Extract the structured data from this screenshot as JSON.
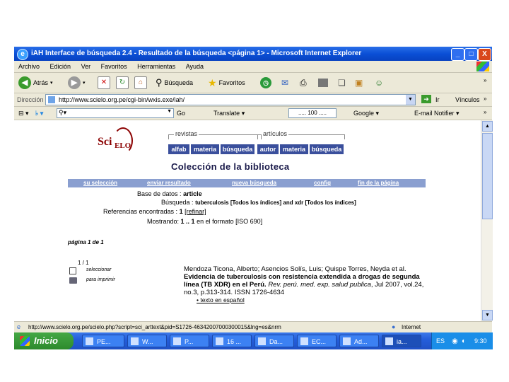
{
  "window": {
    "title": "iAH Interface de búsqueda 2.4 - Resultado de la búsqueda <página 1> - Microsoft Internet Explorer",
    "min_label": "_",
    "max_label": "□",
    "close_label": "X"
  },
  "menubar": [
    "Archivo",
    "Edición",
    "Ver",
    "Favoritos",
    "Herramientas",
    "Ayuda"
  ],
  "toolbar": {
    "back_label": "Atrás",
    "search_label": "Búsqueda",
    "favorites_label": "Favoritos"
  },
  "address": {
    "label": "Dirección",
    "url": "http://www.scielo.org.pe/cgi-bin/wxis.exe/iah/",
    "go_label": "Ir",
    "links_label": "Vínculos"
  },
  "linksbar": {
    "go_label": "Go",
    "translate_label": "Translate",
    "zoom_value": "..... 100 .....",
    "google_label": "Google",
    "email_label": "E-mail Notifier"
  },
  "page": {
    "logo_sci": "Sci",
    "logo_elo": "ELO",
    "revistas_label": "revistas",
    "articulos_label": "artículos",
    "nav": [
      "alfab",
      "materia",
      "búsqueda",
      "autor",
      "materia",
      "búsqueda"
    ],
    "heading": "Colección de la biblioteca",
    "actions": [
      "su selección",
      "enviar resultado",
      "nueva búsqueda",
      "config",
      "fin de la página"
    ],
    "db_label": "Base de datos :",
    "db_value": "article",
    "search_label": "Búsqueda :",
    "search_value": "tuberculosis [Todos los índices] and xdr [Todos los índices]",
    "refs_label": "Referencias encontradas :",
    "refs_value": "1",
    "refine_label": "[refinar]",
    "showing_label": "Mostrando:",
    "showing_value": "1 .. 1",
    "format_value": "en el formato [ISO 690]",
    "pagination": "página 1 de 1",
    "result_index": "1 / 1",
    "select_label": "seleccionar",
    "print_label": "para imprimir",
    "reference": {
      "authors": "Mendoza Ticona, Alberto; Asencios Solís, Luis; Quispe Torres, Neyda et al.",
      "title": "Evidencia de tuberculosis con resistencia extendida a drogas de segunda línea (TB XDR) en el Perú.",
      "journal": "Rev. perú. med. exp. salud publica",
      "details": ", Jul 2007, vol.24, no.3, p.313-314. ISSN 1726-4634",
      "fulltext": "• texto en español"
    }
  },
  "statusbar": {
    "url": "http://www.scielo.org.pe/scielo.php?script=sci_arttext&pid=S1726-46342007000300015&lng=es&nrm",
    "zone": "Internet"
  },
  "taskbar": {
    "start_label": "Inicio",
    "tasks": [
      "PE...",
      "W...",
      "P...",
      "16 ...",
      "Da...",
      "EC...",
      "Ad...",
      "ia..."
    ],
    "lang": "ES",
    "clock": "9:30"
  }
}
